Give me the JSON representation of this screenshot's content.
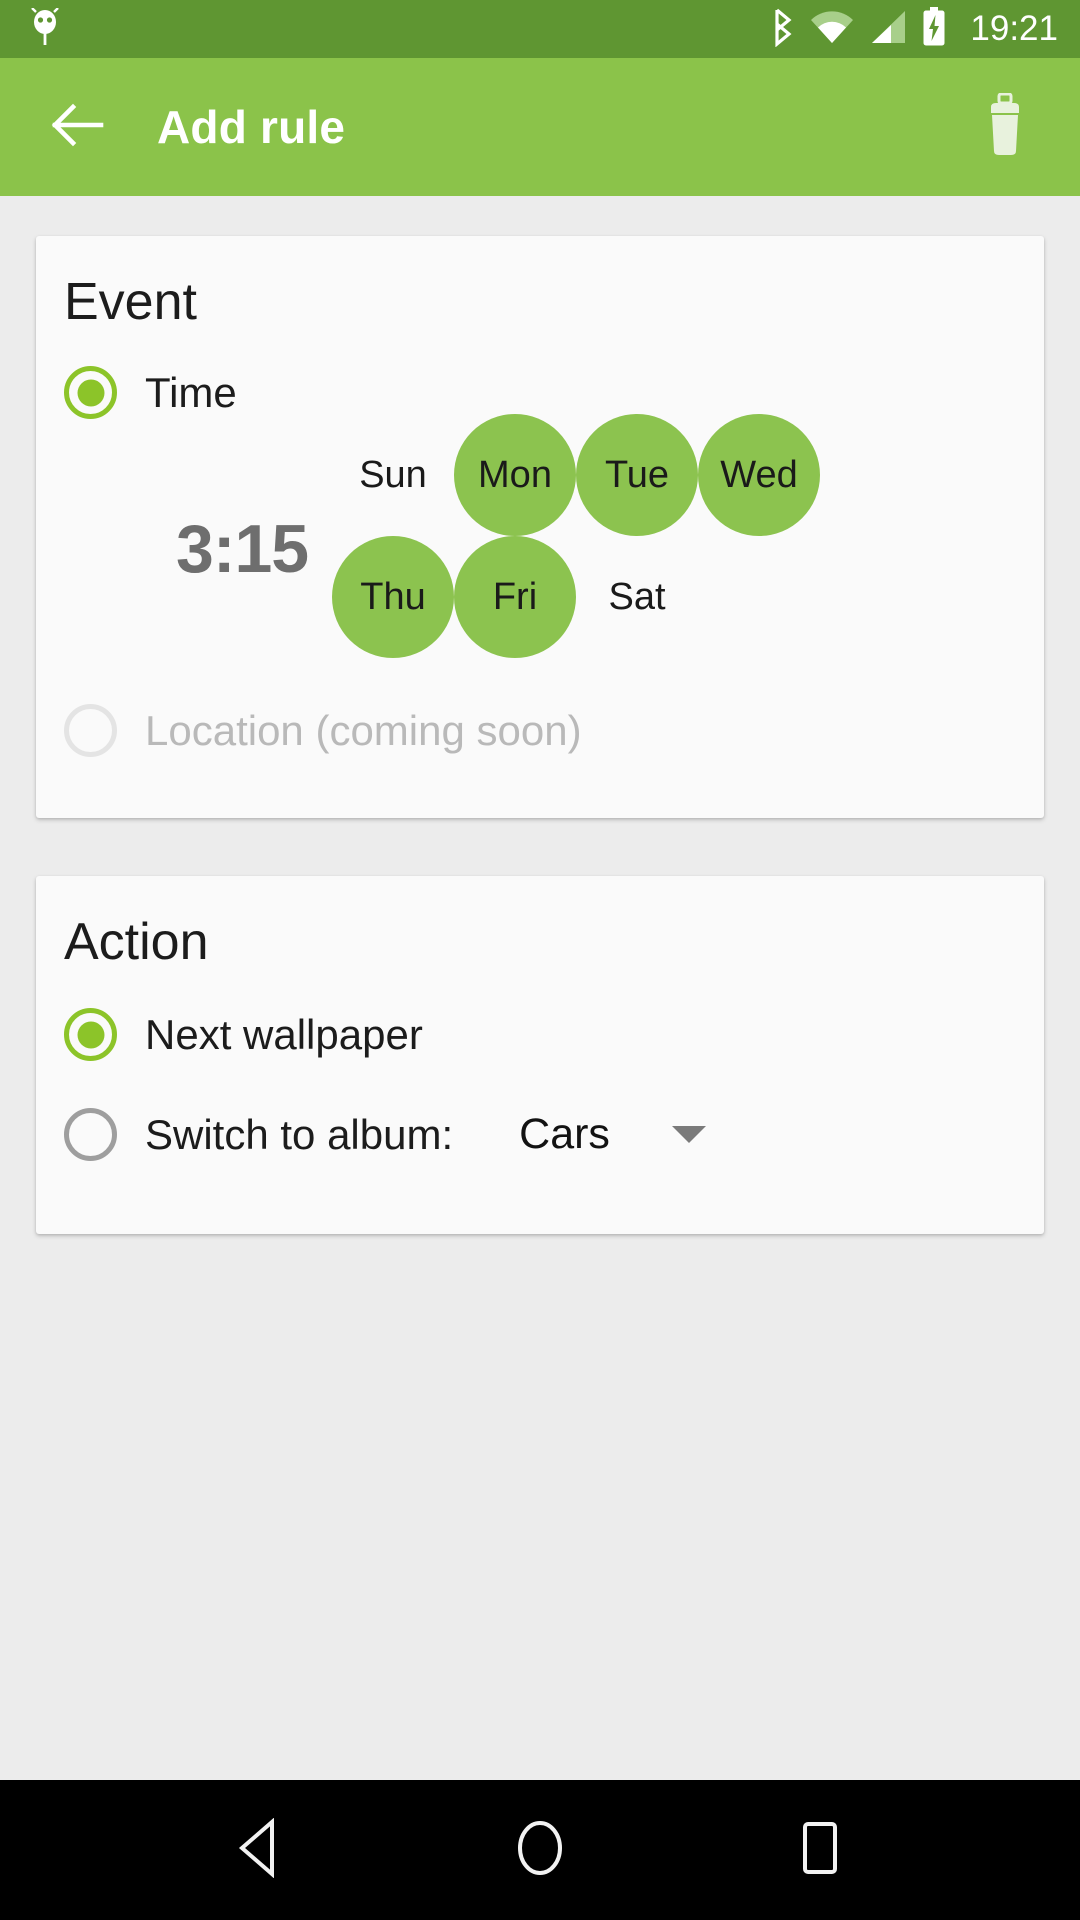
{
  "status_bar": {
    "clock": "19:21",
    "icons": [
      "android-head-icon",
      "bluetooth-icon",
      "wifi-icon",
      "cellular-signal-icon",
      "battery-charging-icon"
    ],
    "background_color": "#5f9632"
  },
  "app_bar": {
    "title": "Add rule",
    "back_icon": "arrow-left-icon",
    "delete_icon": "trash-icon",
    "background_color": "#8bc34a",
    "text_color": "#ffffff"
  },
  "event_card": {
    "title": "Event",
    "options": [
      {
        "label": "Time",
        "selected": true,
        "enabled": true
      },
      {
        "label": "Location (coming soon)",
        "selected": false,
        "enabled": false
      }
    ],
    "time": "3:15",
    "days": [
      {
        "label": "Sun",
        "selected": false
      },
      {
        "label": "Mon",
        "selected": true
      },
      {
        "label": "Tue",
        "selected": true
      },
      {
        "label": "Wed",
        "selected": true
      },
      {
        "label": "Thu",
        "selected": true
      },
      {
        "label": "Fri",
        "selected": true
      },
      {
        "label": "Sat",
        "selected": false
      }
    ]
  },
  "action_card": {
    "title": "Action",
    "options": [
      {
        "label": "Next wallpaper",
        "selected": true
      },
      {
        "label": "Switch to album:",
        "selected": false
      }
    ],
    "album_selected": "Cars",
    "dropdown_icon": "chevron-down-icon"
  },
  "nav_bar": {
    "back_icon": "nav-back-triangle-icon",
    "home_icon": "nav-home-circle-icon",
    "recents_icon": "nav-recents-square-icon",
    "background_color": "#000000"
  },
  "theme": {
    "accent_green": "#8bc34a",
    "radio_green": "#8cc429",
    "day_green": "#8cc34f",
    "status_green": "#5f9632",
    "page_background": "#ececec",
    "card_background": "#fafafa",
    "muted_text": "#b9b9b9",
    "time_text": "#6e6e6e"
  }
}
